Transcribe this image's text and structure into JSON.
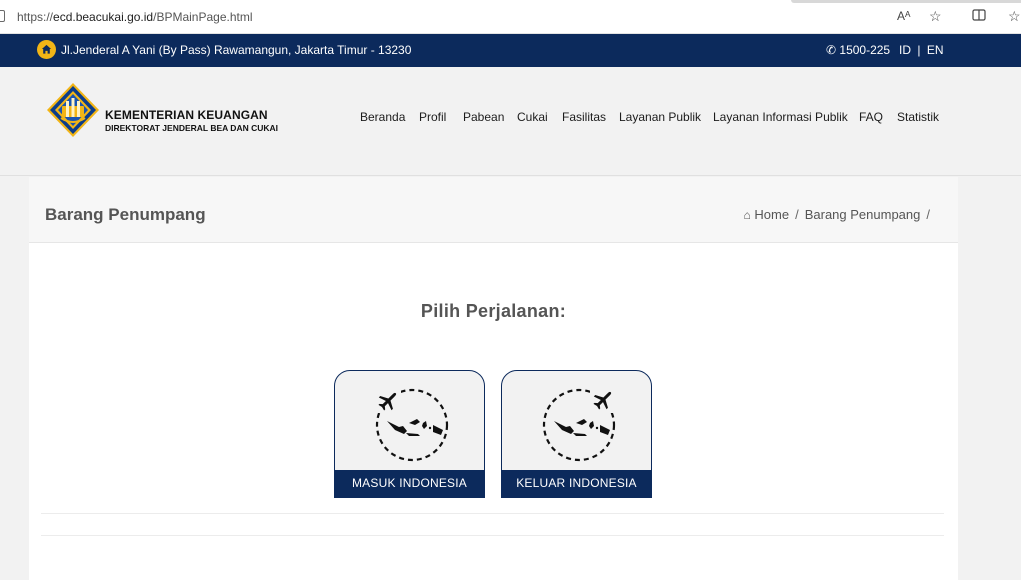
{
  "browser": {
    "url_prefix": "https://",
    "url_host": "ecd.beacukai.go.id",
    "url_path": "/BPMainPage.html",
    "read_aloud_icon": "Aᴬ"
  },
  "topbar": {
    "address": "Jl.Jenderal A Yani (By Pass) Rawamangun, Jakarta Timur - 13230",
    "phone": "1500-225",
    "lang_id": "ID",
    "lang_sep": "|",
    "lang_en": "EN"
  },
  "brand": {
    "title": "KEMENTERIAN KEUANGAN",
    "subtitle": "DIREKTORAT JENDERAL BEA DAN CUKAI"
  },
  "nav": {
    "items": [
      {
        "label": "Beranda"
      },
      {
        "label": "Profil"
      },
      {
        "label": "Pabean"
      },
      {
        "label": "Cukai"
      },
      {
        "label": "Fasilitas"
      },
      {
        "label": "Layanan Publik"
      },
      {
        "label": "Layanan Informasi Publik"
      },
      {
        "label": "FAQ"
      },
      {
        "label": "Statistik"
      }
    ]
  },
  "page": {
    "title": "Barang Penumpang",
    "breadcrumb": {
      "home": "Home",
      "current": "Barang Penumpang",
      "separator": "/"
    }
  },
  "main": {
    "prompt": "Pilih Perjalanan:",
    "choices": [
      {
        "label": "MASUK INDONESIA"
      },
      {
        "label": "KELUAR INDONESIA"
      }
    ]
  },
  "colors": {
    "navy": "#0c2a5c",
    "accent_yellow": "#f2b516"
  }
}
